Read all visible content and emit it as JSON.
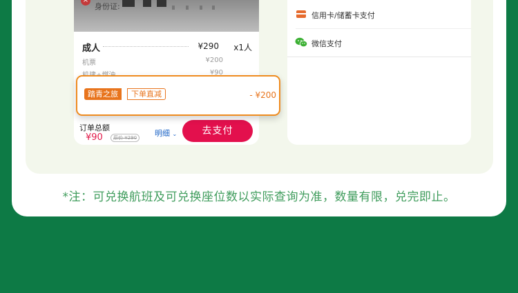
{
  "left_panel": {
    "id_label": "身份证:",
    "fare_rows": [
      {
        "label": "成人",
        "price": "¥290",
        "qty": "x1人"
      },
      {
        "label": "机票",
        "price": "¥200"
      },
      {
        "label": "机建+燃油",
        "price": "¥90"
      }
    ],
    "promo": {
      "tag_primary": "踏青之旅",
      "tag_secondary": "下单直减",
      "amount": "- ¥200"
    },
    "summary": {
      "total_label": "订单总额",
      "total_price": "¥90",
      "original_price": "原价 ¥290",
      "detail_link": "明细",
      "pay_button": "去支付"
    }
  },
  "right_panel": {
    "payment_methods": [
      {
        "label": "信用卡/储蓄卡支付",
        "icon": "bank-card-icon"
      },
      {
        "label": "微信支付",
        "icon": "wechat-icon"
      }
    ]
  },
  "footnote": "*注：可兑换航班及可兑换座位数以实际查询为准，数量有限，兑完即止。",
  "colors": {
    "background": "#0d7a45",
    "pay_button": "#e3104d",
    "promo_orange": "#e8741c",
    "footnote_green": "#3f9c5c"
  }
}
